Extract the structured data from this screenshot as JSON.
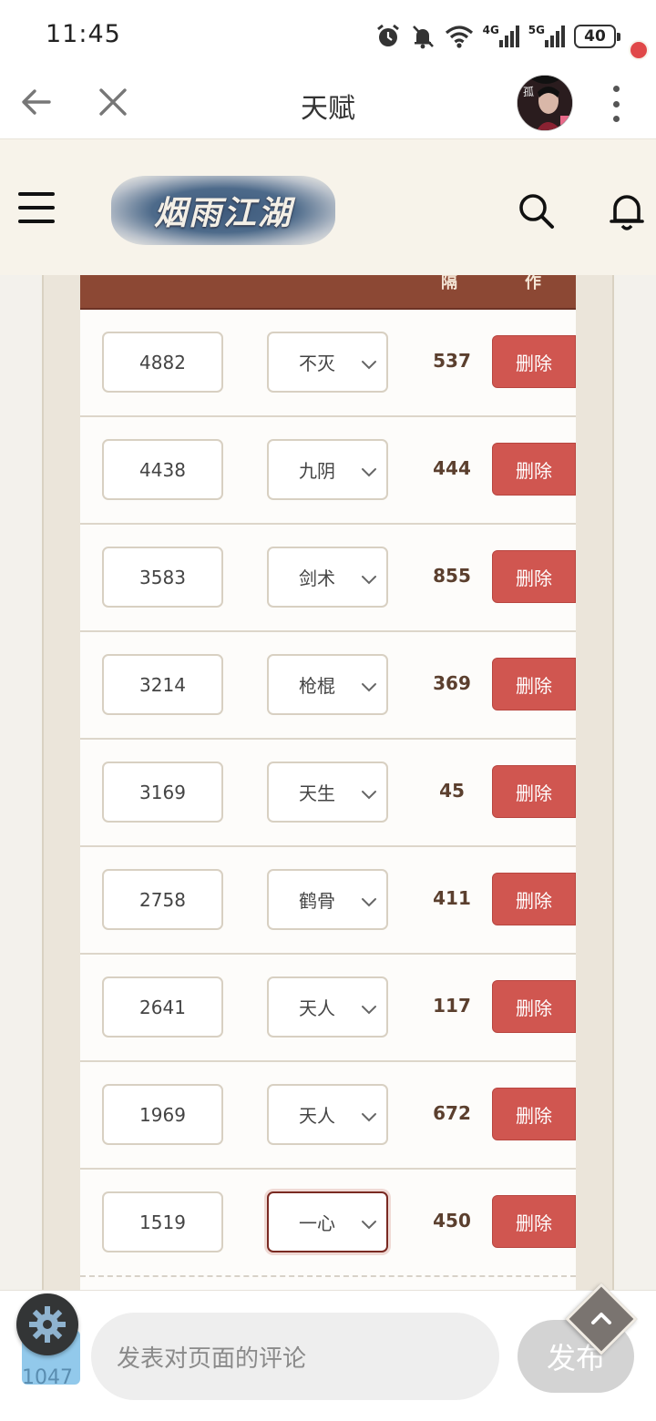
{
  "status_bar": {
    "time": "11:45",
    "battery": "40",
    "net1": "4G",
    "net2": "5G"
  },
  "browser": {
    "title": "天赋"
  },
  "site": {
    "logo_text": "烟雨江湖"
  },
  "table": {
    "header_partial": [
      "隔",
      "作"
    ],
    "rows": [
      {
        "id": "4882",
        "type": "不灭",
        "value": "537",
        "action": "删除"
      },
      {
        "id": "4438",
        "type": "九阴",
        "value": "444",
        "action": "删除"
      },
      {
        "id": "3583",
        "type": "剑术",
        "value": "855",
        "action": "删除"
      },
      {
        "id": "3214",
        "type": "枪棍",
        "value": "369",
        "action": "删除"
      },
      {
        "id": "3169",
        "type": "天生",
        "value": "45",
        "action": "删除"
      },
      {
        "id": "2758",
        "type": "鹤骨",
        "value": "411",
        "action": "删除"
      },
      {
        "id": "2641",
        "type": "天人",
        "value": "117",
        "action": "删除"
      },
      {
        "id": "1969",
        "type": "天人",
        "value": "672",
        "action": "删除"
      },
      {
        "id": "1519",
        "type": "一心",
        "value": "450",
        "action": "删除"
      }
    ]
  },
  "comment": {
    "placeholder": "发表对页面的评论",
    "publish_label": "发布",
    "counter": "1047"
  },
  "colors": {
    "header_bar": "#8c4834",
    "delete_button": "#d05650",
    "bell_dot": "#e04848"
  }
}
